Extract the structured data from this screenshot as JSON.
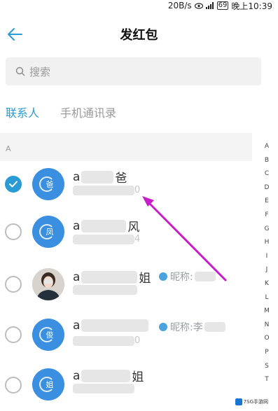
{
  "status_bar": {
    "speed": "20B/s",
    "time": "晚上10:39",
    "battery": "69"
  },
  "header": {
    "title": "发红包"
  },
  "search": {
    "placeholder": "搜索"
  },
  "tabs": [
    {
      "label": "联系人",
      "active": true
    },
    {
      "label": "手机通讯录",
      "active": false
    }
  ],
  "section": {
    "letter": "A"
  },
  "contacts": [
    {
      "name_prefix": "a",
      "name_suffix": "爸",
      "number_tail": "0",
      "avatar_char": "爸",
      "checked": true
    },
    {
      "name_prefix": "a",
      "name_suffix": "风",
      "number_tail": "4",
      "avatar_char": "凤",
      "checked": false
    },
    {
      "name_prefix": "a",
      "name_suffix": "姐",
      "number_tail": "",
      "avatar_char": "",
      "checked": false,
      "nickname": "昵称:"
    },
    {
      "name_prefix": "a",
      "name_suffix": "",
      "number_tail": "0",
      "avatar_char": "俊",
      "checked": false,
      "nickname": "昵称:李"
    },
    {
      "name_prefix": "a",
      "name_suffix": "姐",
      "number_tail": "",
      "avatar_char": "姐",
      "checked": false
    }
  ],
  "alphabet": [
    "A",
    "B",
    "C",
    "D",
    "E",
    "F",
    "G",
    "H",
    "I",
    "J",
    "K",
    "L",
    "M",
    "N",
    "O",
    "P",
    "S",
    "T"
  ],
  "watermark": "7SG手游网",
  "colors": {
    "accent": "#2b9bd6",
    "avatar": "#3a8fe0",
    "annotation_arrow": "#c81ec8"
  }
}
